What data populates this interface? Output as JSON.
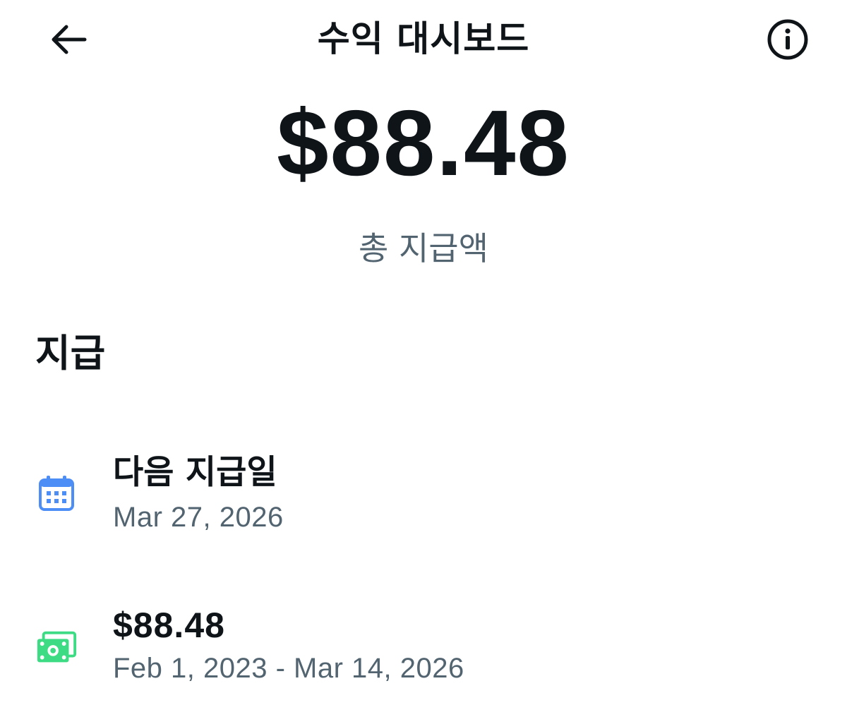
{
  "header": {
    "title": "수익 대시보드",
    "back_icon": "arrow-left-icon",
    "info_icon": "info-circle-icon"
  },
  "summary": {
    "total_amount": "$88.48",
    "caption": "총 지급액"
  },
  "payouts": {
    "section_title": "지급",
    "items": [
      {
        "icon": "calendar-icon",
        "icon_color": "#4c8df6",
        "title": "다음 지급일",
        "subtitle": "Mar 27, 2026"
      },
      {
        "icon": "money-bills-icon",
        "icon_color": "#3ddc84",
        "title": "$88.48",
        "subtitle": "Feb 1, 2023 - Mar 14, 2026"
      }
    ]
  }
}
